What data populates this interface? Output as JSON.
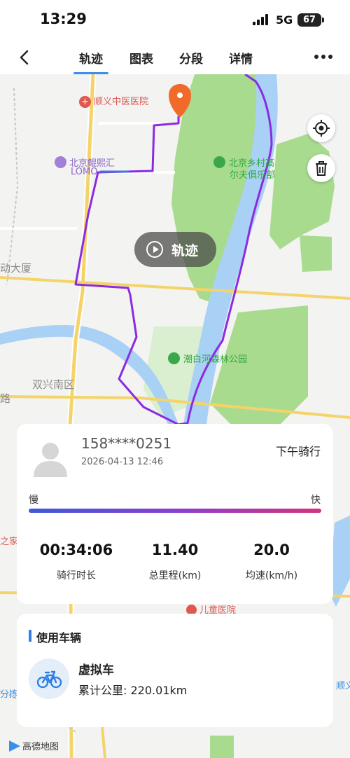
{
  "status": {
    "time": "13:29",
    "network": "5G",
    "battery": "67",
    "battery_level": 0.67
  },
  "nav": {
    "tabs": [
      "轨迹",
      "图表",
      "分段",
      "详情"
    ],
    "active_tab": "轨迹"
  },
  "map": {
    "labels": {
      "hospital": "顺义中医医院",
      "mall_1": "北京鲲熙汇",
      "mall_2": "LOMO",
      "golf_1": "北京乡村高",
      "golf_2": "尔夫俱乐部",
      "building": "动大厦",
      "park": "潮白河森林公园",
      "district": "双兴南区",
      "road": "路",
      "home": "之家",
      "children_hospital": "儿童医院",
      "shunxin": "顺义",
      "fen": "分拣中"
    },
    "play_label": "轨迹",
    "logo": "高德地图"
  },
  "ride": {
    "user": "158****0251",
    "datetime": "2026-04-13 12:46",
    "type": "下午骑行",
    "speed_slow": "慢",
    "speed_fast": "快",
    "stats": [
      {
        "value": "00:34:06",
        "label": "骑行时长"
      },
      {
        "value": "11.40",
        "label": "总里程(km)"
      },
      {
        "value": "20.0",
        "label": "均速(km/h)"
      }
    ]
  },
  "vehicle": {
    "section_title": "使用车辆",
    "name": "虚拟车",
    "total_distance": "累计公里: 220.01km"
  },
  "colors": {
    "accent": "#3a8fe8",
    "route": "#8a2be2",
    "river": "#a9d0f5",
    "park": "#a9db8f"
  }
}
